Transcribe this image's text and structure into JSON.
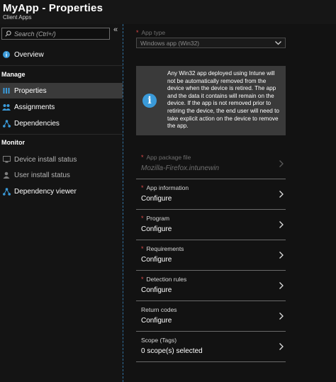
{
  "header": {
    "title": "MyApp - Properties",
    "subtitle": "Client Apps"
  },
  "sidebar": {
    "collapse_icon": "«",
    "search_placeholder": "Search (Ctrl+/)",
    "overview": "Overview",
    "manage_heading": "Manage",
    "manage_items": [
      {
        "label": "Properties",
        "icon": "properties-icon",
        "active": true
      },
      {
        "label": "Assignments",
        "icon": "assignments-icon"
      },
      {
        "label": "Dependencies",
        "icon": "dependencies-icon"
      }
    ],
    "monitor_heading": "Monitor",
    "monitor_items": [
      {
        "label": "Device install status",
        "icon": "device-icon"
      },
      {
        "label": "User install status",
        "icon": "user-icon"
      },
      {
        "label": "Dependency viewer",
        "icon": "dependency-viewer-icon"
      }
    ]
  },
  "main": {
    "app_type_label": "App type",
    "app_type_value": "Windows app (Win32)",
    "info_text": "Any Win32 app deployed using Intune will not be automatically removed from the device when the device is retired. The app and the data it contains will remain on the device. If the app is not removed prior to retiring the device, the end user will need to take explicit action on the device to remove the app.",
    "rows": [
      {
        "label": "App package file",
        "value": "Mozilla-Firefox.intunewin",
        "required": true,
        "disabled": true
      },
      {
        "label": "App information",
        "value": "Configure",
        "required": true
      },
      {
        "label": "Program",
        "value": "Configure",
        "required": true
      },
      {
        "label": "Requirements",
        "value": "Configure",
        "required": true
      },
      {
        "label": "Detection rules",
        "value": "Configure",
        "required": true
      },
      {
        "label": "Return codes",
        "value": "Configure",
        "required": false
      },
      {
        "label": "Scope (Tags)",
        "value": "0 scope(s) selected",
        "required": false
      }
    ]
  },
  "colors": {
    "accent": "#3a9ad9",
    "required": "#e04a4a",
    "active_bg": "#3a3a3a"
  }
}
